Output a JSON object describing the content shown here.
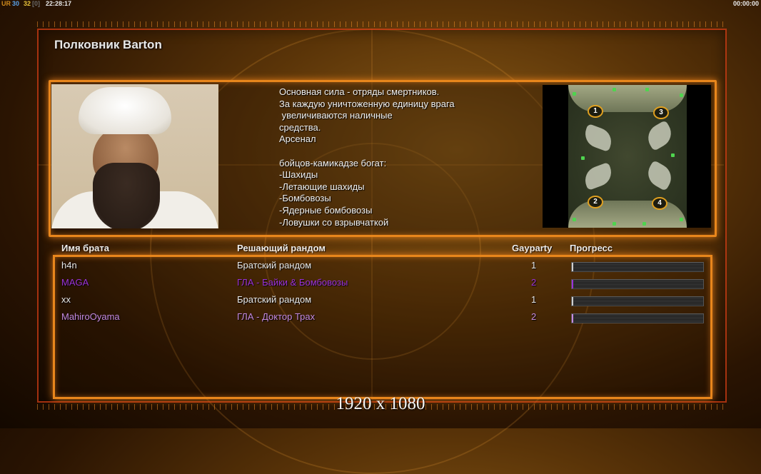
{
  "hud": {
    "ur_label": "UR",
    "num_a": "30",
    "num_b": "32",
    "num_c": "[0]",
    "time": "22:28:17",
    "clock": "00:00:00"
  },
  "general": {
    "title": "Полковник Barton",
    "description": "Основная сила - отряды смертников.\nЗа каждую уничтоженную единицу врага\n увеличиваются наличные\nсредства.\nАрсенал\n\nбойцов-камикадзе богат:\n-Шахиды\n-Летающие шахиды\n-Бомбовозы\n-Ядерные бомбовозы\n-Ловушки со взрывчаткой"
  },
  "map": {
    "start_positions": [
      "1",
      "3",
      "2",
      "4"
    ]
  },
  "table": {
    "headers": {
      "name": "Имя брата",
      "faction": "Решающий рандом",
      "team": "Gayparty",
      "progress": "Прогресс"
    },
    "rows": [
      {
        "name": "h4n",
        "faction": "Братский рандом",
        "team": "1",
        "color": "#e8e8e8",
        "progress": 0.01
      },
      {
        "name": "MAGA",
        "faction": "ГЛА - Байки & Бомбовозы",
        "team": "2",
        "color": "#9a32d8",
        "progress": 0.01
      },
      {
        "name": "xx",
        "faction": "Братский рандом",
        "team": "1",
        "color": "#e8e8e8",
        "progress": 0.0
      },
      {
        "name": "MahiroOyama",
        "faction": "ГЛА - Доктор Трах",
        "team": "2",
        "color": "#c58ae0",
        "progress": 0.0
      }
    ]
  },
  "footer": {
    "resolution": "1920 x 1080"
  }
}
